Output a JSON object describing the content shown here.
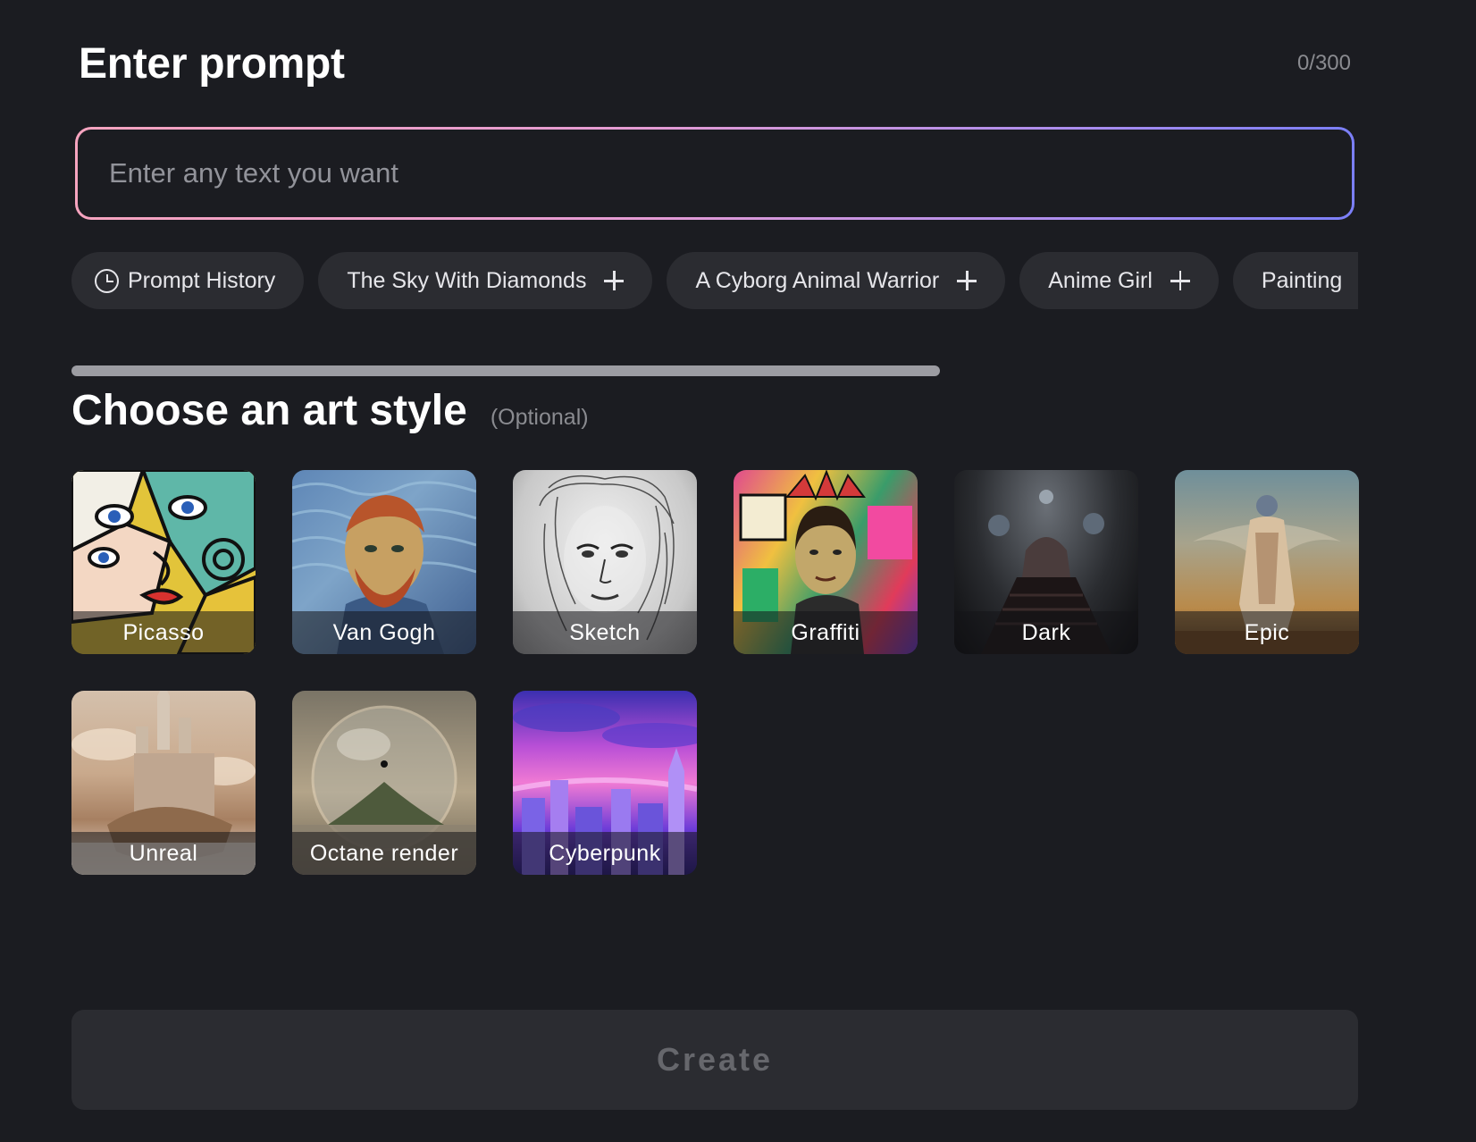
{
  "prompt": {
    "title": "Enter prompt",
    "counter": "0/300",
    "input_value": "",
    "input_placeholder": "Enter any text you want"
  },
  "chips": [
    {
      "label": "Prompt History",
      "icon": "clock-icon"
    },
    {
      "label": "The Sky With Diamonds",
      "icon": "plus-icon"
    },
    {
      "label": "A Cyborg Animal Warrior",
      "icon": "plus-icon"
    },
    {
      "label": "Anime Girl",
      "icon": "plus-icon"
    },
    {
      "label": "Painting",
      "icon": "plus-icon"
    }
  ],
  "styles": {
    "title": "Choose an art style",
    "optional_label": "(Optional)",
    "items": [
      {
        "label": "Picasso"
      },
      {
        "label": "Van Gogh"
      },
      {
        "label": "Sketch"
      },
      {
        "label": "Graffiti"
      },
      {
        "label": "Dark"
      },
      {
        "label": "Epic"
      },
      {
        "label": "Unreal"
      },
      {
        "label": "Octane render"
      },
      {
        "label": "Cyberpunk"
      }
    ]
  },
  "create_button": {
    "label": "Create"
  },
  "colors": {
    "background": "#1b1c21",
    "chip": "#2b2c31",
    "gradient_start": "#f6a4bf",
    "gradient_end": "#7b7ff8",
    "muted_text": "#8a8b90"
  }
}
